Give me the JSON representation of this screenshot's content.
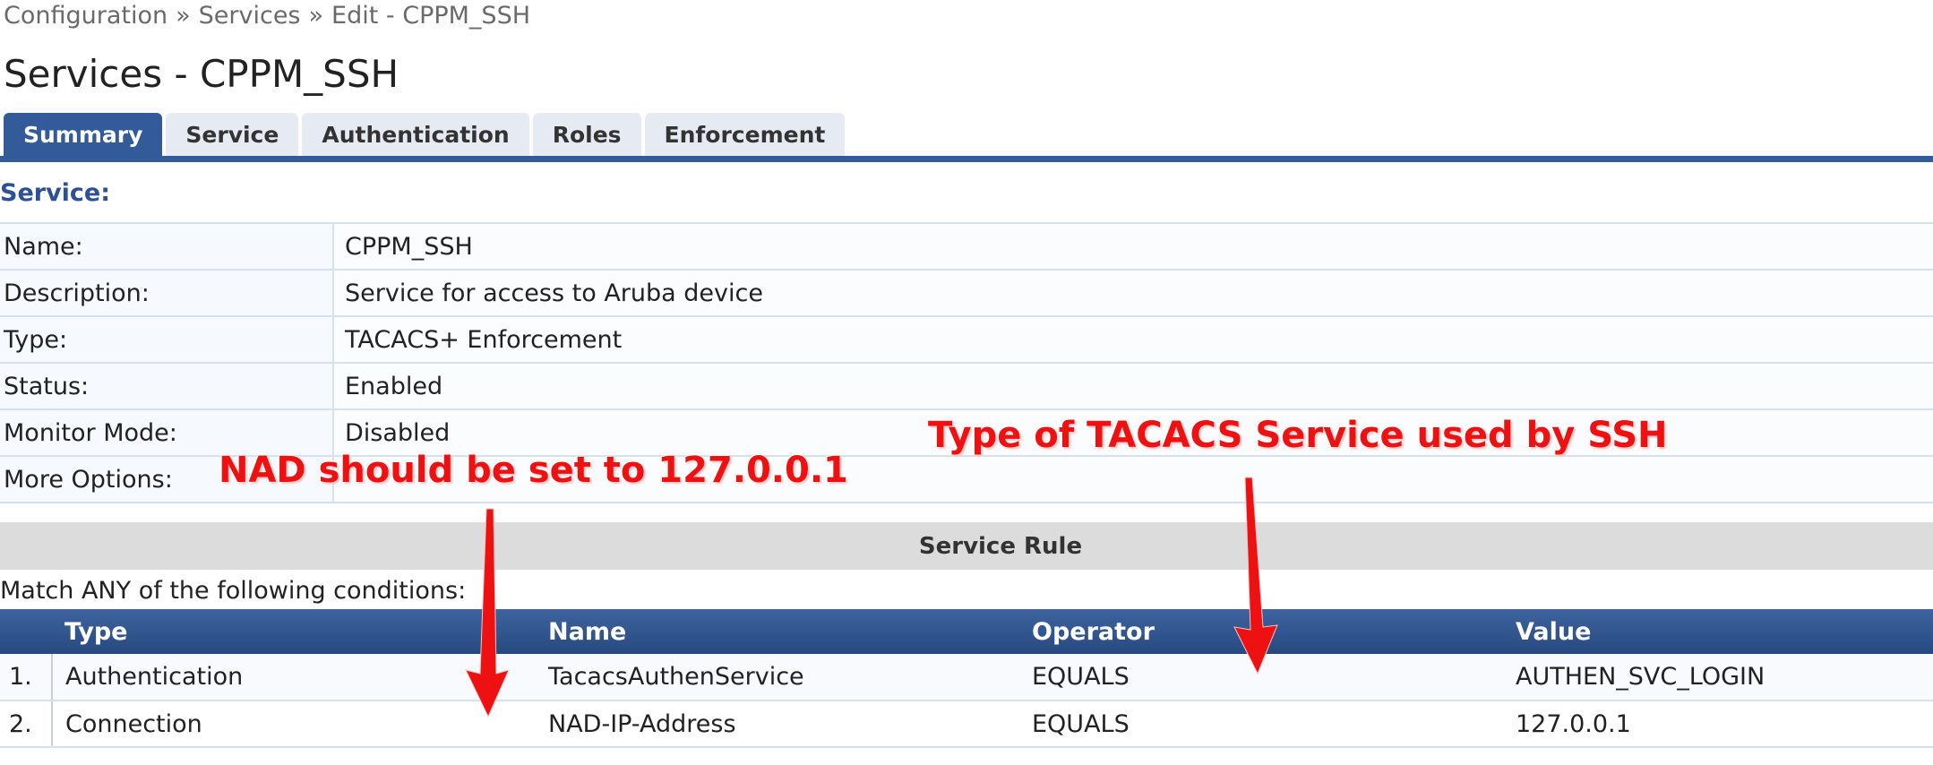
{
  "breadcrumb": {
    "items": [
      "Configuration",
      "Services",
      "Edit - CPPM_SSH"
    ],
    "separator": "»"
  },
  "page": {
    "title": "Services - CPPM_SSH"
  },
  "tabs": [
    {
      "label": "Summary",
      "active": true
    },
    {
      "label": "Service",
      "active": false
    },
    {
      "label": "Authentication",
      "active": false
    },
    {
      "label": "Roles",
      "active": false
    },
    {
      "label": "Enforcement",
      "active": false
    }
  ],
  "service_section": {
    "heading": "Service:",
    "rows": [
      {
        "key": "Name:",
        "value": "CPPM_SSH"
      },
      {
        "key": "Description:",
        "value": "Service for access to Aruba device"
      },
      {
        "key": "Type:",
        "value": "TACACS+ Enforcement"
      },
      {
        "key": "Status:",
        "value": "Enabled"
      },
      {
        "key": "Monitor Mode:",
        "value": "Disabled"
      },
      {
        "key": "More Options:",
        "value": ""
      }
    ]
  },
  "service_rule": {
    "heading": "Service Rule",
    "match_text": "Match ANY of the following conditions:",
    "columns": [
      "Type",
      "Name",
      "Operator",
      "Value"
    ],
    "rows": [
      {
        "num": "1.",
        "type": "Authentication",
        "name": "TacacsAuthenService",
        "operator": "EQUALS",
        "value": "AUTHEN_SVC_LOGIN"
      },
      {
        "num": "2.",
        "type": "Connection",
        "name": "NAD-IP-Address",
        "operator": "EQUALS",
        "value": "127.0.0.1"
      }
    ]
  },
  "annotations": {
    "nad_note": "NAD should be set to 127.0.0.1",
    "tacacs_note": "Type of TACACS Service used by SSH",
    "color": "#ee1111"
  },
  "colors": {
    "accent": "#335a99",
    "heading": "#2e5196",
    "table_header": "#26497f"
  }
}
